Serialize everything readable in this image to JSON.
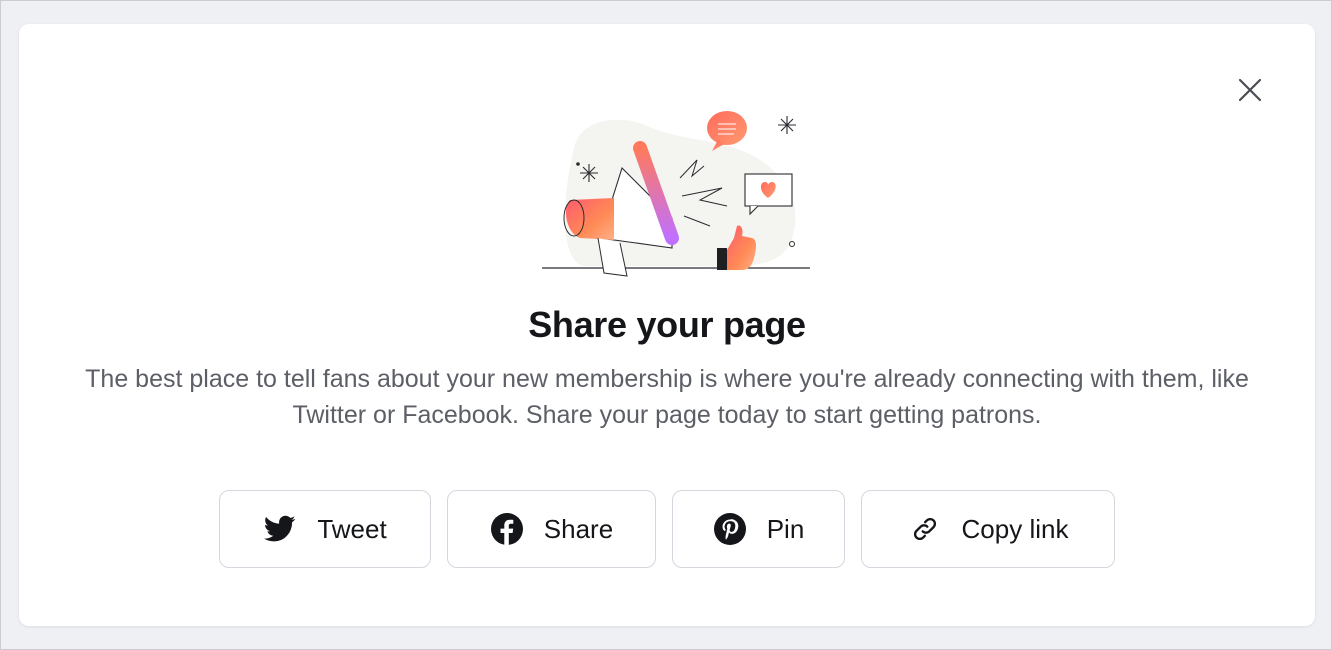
{
  "modal": {
    "title": "Share your page",
    "description": "The best place to tell fans about your new membership is where you're already connecting with them, like Twitter or Facebook. Share your page today to start getting patrons.",
    "close_icon": "close-icon"
  },
  "buttons": [
    {
      "label": "Tweet",
      "icon": "twitter-icon"
    },
    {
      "label": "Share",
      "icon": "facebook-icon"
    },
    {
      "label": "Pin",
      "icon": "pinterest-icon"
    },
    {
      "label": "Copy link",
      "icon": "link-icon"
    }
  ],
  "colors": {
    "text_primary": "#14161a",
    "text_secondary": "#5c5f66",
    "button_border": "#d4d7dd",
    "accent_gradient_start": "#ff6a5c",
    "accent_gradient_end": "#c070ff"
  }
}
